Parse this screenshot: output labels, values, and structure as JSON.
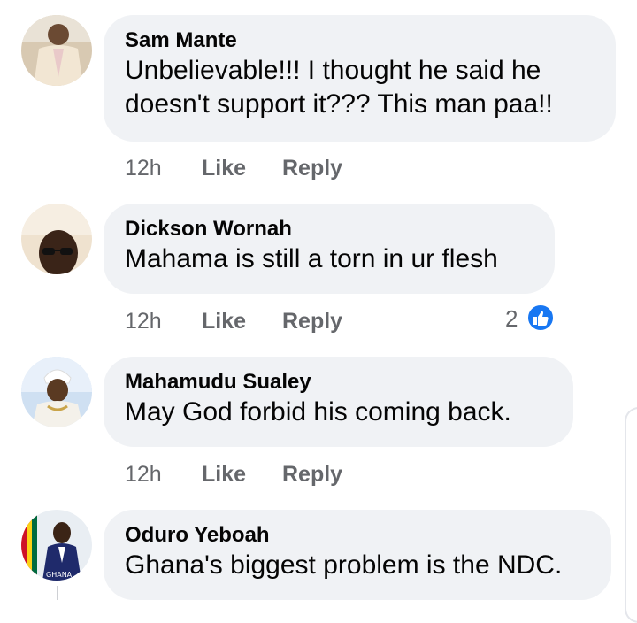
{
  "comments": [
    {
      "author": "Sam Mante",
      "text_lines": [
        "Unbelievable!!! I thought he said he",
        "doesn't support it??? This man paa!!"
      ],
      "time": "12h",
      "like_label": "Like",
      "reply_label": "Reply"
    },
    {
      "author": "Dickson Wornah",
      "text_lines": [
        "Mahama is still a torn in ur flesh"
      ],
      "time": "12h",
      "like_label": "Like",
      "reply_label": "Reply",
      "reaction_count": "2",
      "reaction_icon": "thumbs-up-icon"
    },
    {
      "author": "Mahamudu Sualey",
      "text_lines": [
        "May God forbid his coming back."
      ],
      "time": "12h",
      "like_label": "Like",
      "reply_label": "Reply"
    },
    {
      "author": "Oduro Yeboah",
      "text_lines": [
        "Ghana's biggest problem is the NDC."
      ],
      "avatar_caption": "GHANA"
    }
  ],
  "colors": {
    "bubble": "#f0f2f5",
    "meta_text": "#65676b",
    "like_blue": "#1877f2"
  }
}
